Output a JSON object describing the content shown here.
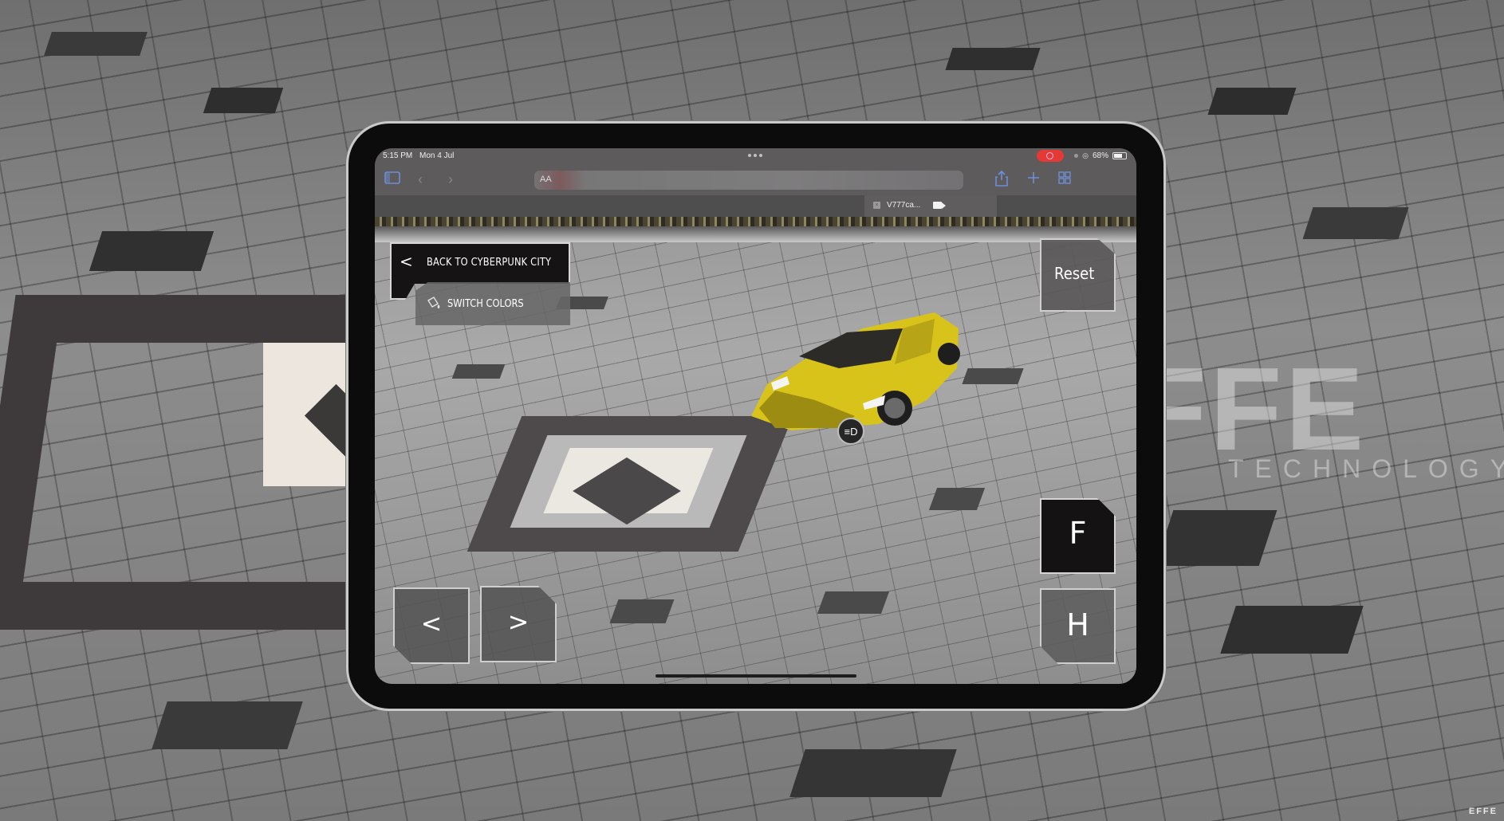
{
  "status_bar": {
    "time": "5:15 PM",
    "date": "Mon 4 Jul",
    "battery_percent": "68%",
    "recording_indicator_color": "#e53935"
  },
  "browser": {
    "url_text_size_label": "AA",
    "url": "",
    "tab": {
      "title": "V777ca...",
      "icon": "camera-icon"
    },
    "icons": {
      "sidebar": "sidebar-icon",
      "back": "chevron-left-icon",
      "forward": "chevron-right-icon",
      "share": "share-icon",
      "new_tab": "plus-icon",
      "tabs_overview": "grid-icon"
    },
    "accent_color": "#6d8fd8"
  },
  "app": {
    "back_button": {
      "arrow": "<",
      "label": "BACK TO CYBERPUNK CITY"
    },
    "switch_colors_button": {
      "label": "SWITCH COLORS",
      "icon": "paint-bucket-icon"
    },
    "reset_button": {
      "label": "Reset"
    },
    "prev_button": {
      "label": "<"
    },
    "next_button": {
      "label": ">"
    },
    "f_button": {
      "label": "F"
    },
    "h_button": {
      "label": "H"
    },
    "headlight_button": {
      "icon": "headlight-icon",
      "glyph": "≡D"
    },
    "car_color": "#d9c41a"
  },
  "watermark": {
    "brand": "EFFE",
    "sub": "TECHNOLOGY",
    "corner": "EFFE"
  }
}
